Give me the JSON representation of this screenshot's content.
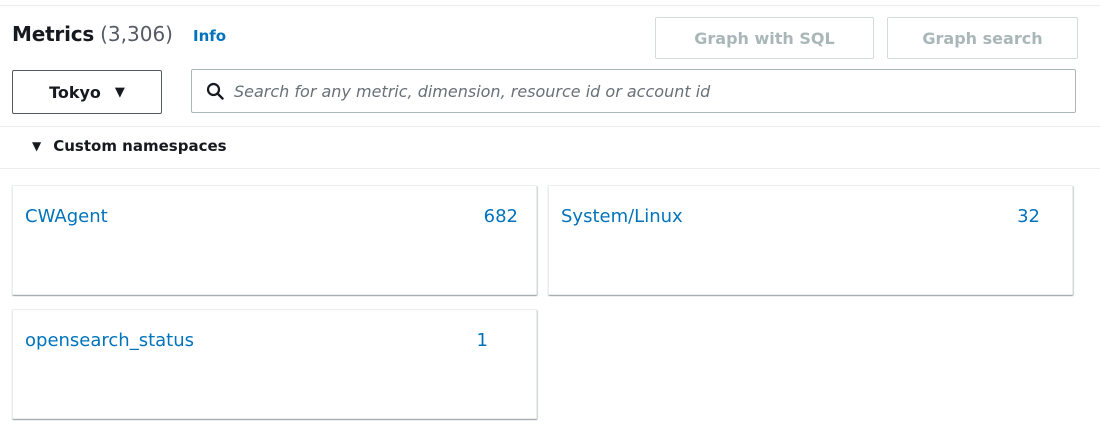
{
  "header": {
    "title": "Metrics",
    "count": "(3,306)",
    "info_label": "Info",
    "graph_sql_label": "Graph with SQL",
    "graph_search_label": "Graph search"
  },
  "region": {
    "label": "Tokyo",
    "caret": "▼"
  },
  "search": {
    "placeholder": "Search for any metric, dimension, resource id or account id",
    "value": ""
  },
  "section": {
    "toggle": "▼",
    "label": "Custom namespaces"
  },
  "namespaces": [
    {
      "name": "CWAgent",
      "count": "682"
    },
    {
      "name": "System/Linux",
      "count": "32"
    },
    {
      "name": "opensearch_status",
      "count": "1"
    }
  ],
  "colors": {
    "link": "#0073bb",
    "text": "#16191f",
    "disabled_button_text": "#aab7b8",
    "border": "#eaeded"
  }
}
